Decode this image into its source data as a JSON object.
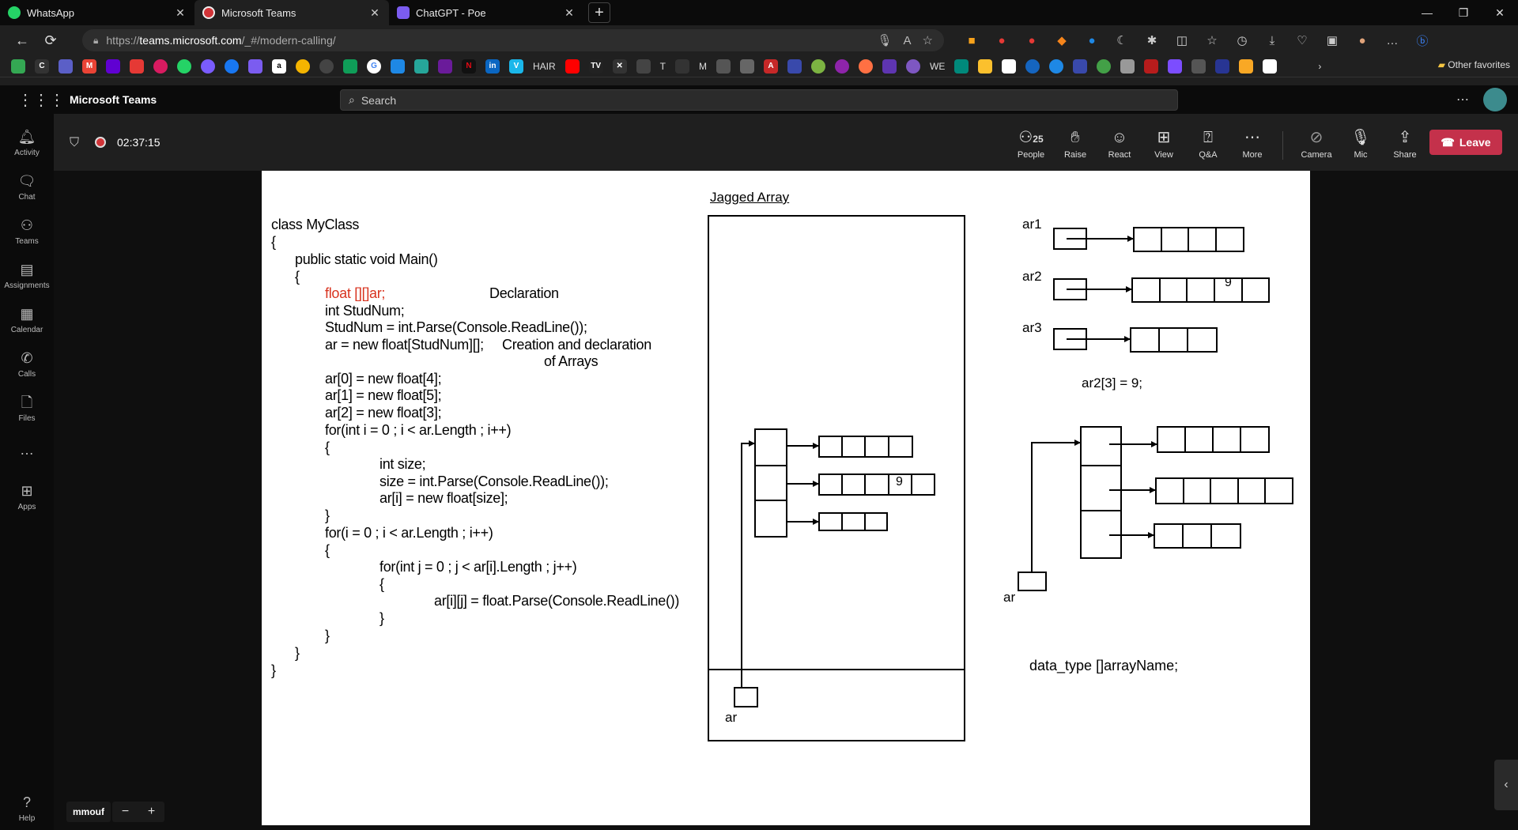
{
  "browser": {
    "tabs": [
      {
        "title": "WhatsApp",
        "close": "✕",
        "color": "#25d366"
      },
      {
        "title": "Microsoft Teams",
        "close": "✕",
        "color": "#d13438"
      },
      {
        "title": "ChatGPT - Poe",
        "close": "✕",
        "color": "#7b5cf0"
      }
    ],
    "new_tab": "+",
    "window_controls": [
      "—",
      "❐",
      "✕"
    ],
    "url_prefix": "https://",
    "url_host": "teams.microsoft.com",
    "url_path": "/_#/modern-calling/",
    "favorites_text": [
      "HAIR",
      "T",
      "M",
      "WE"
    ],
    "other_favorites": "Other favorites"
  },
  "teams": {
    "app_title": "Microsoft Teams",
    "search_placeholder": "Search",
    "rail": [
      "Activity",
      "Chat",
      "Teams",
      "Assignments",
      "Calendar",
      "Calls",
      "Files",
      "Apps",
      "Help"
    ],
    "rail_more": "…"
  },
  "meeting": {
    "timer": "02:37:15",
    "people_count": "25",
    "controls": [
      "People",
      "Raise",
      "React",
      "View",
      "Q&A",
      "More",
      "Camera",
      "Mic",
      "Share"
    ],
    "leave_label": "Leave",
    "participant_name": "mmouf"
  },
  "slide": {
    "title": "Jagged Array",
    "code_lines": [
      "class MyClass",
      "{",
      "public static void Main()",
      "{",
      "float [][]ar;",
      "int StudNum;",
      "StudNum = int.Parse(Console.ReadLine());",
      "ar = new float[StudNum][];",
      "ar[0] = new float[4];",
      "ar[1] = new float[5];",
      "ar[2] = new float[3];",
      "for(int i = 0 ; i < ar.Length ; i++)",
      "{",
      "int size;",
      "size = int.Parse(Console.ReadLine());",
      "ar[i] = new float[size];",
      "}",
      "for(i = 0 ; i < ar.Length ; i++)",
      "{",
      "for(int j = 0 ; j < ar[i].Length ; j++)",
      "{",
      "ar[i][j] = float.Parse(Console.ReadLine())",
      "}",
      "}",
      "}",
      "}"
    ],
    "annotation_declaration": "Declaration",
    "annotation_creation_1": "Creation and declaration",
    "annotation_creation_2": "of Arrays",
    "label_ar1": "ar1",
    "label_ar2": "ar2",
    "label_ar3": "ar3",
    "label_ar": "ar",
    "assignment": "ar2[3] = 9;",
    "cell_value": "9",
    "syntax": "data_type []arrayName;"
  }
}
